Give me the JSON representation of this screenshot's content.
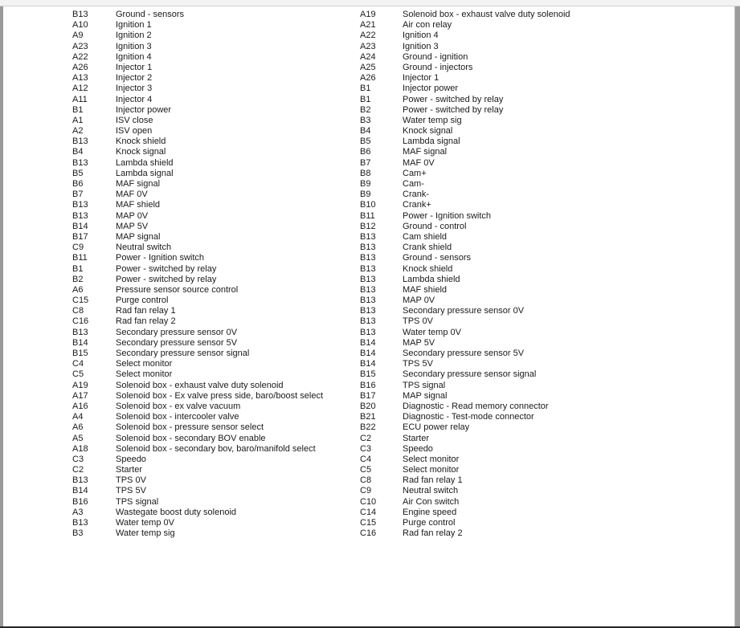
{
  "document": {
    "left_column": [
      {
        "pin": "B13",
        "description": "Ground - sensors"
      },
      {
        "pin": "A10",
        "description": "Ignition 1"
      },
      {
        "pin": "A9",
        "description": "Ignition 2"
      },
      {
        "pin": "A23",
        "description": "Ignition 3"
      },
      {
        "pin": "A22",
        "description": "Ignition 4"
      },
      {
        "pin": "A26",
        "description": "Injector 1"
      },
      {
        "pin": "A13",
        "description": "Injector 2"
      },
      {
        "pin": "A12",
        "description": "Injector 3"
      },
      {
        "pin": "A11",
        "description": "Injector 4"
      },
      {
        "pin": "B1",
        "description": "Injector power"
      },
      {
        "pin": "A1",
        "description": "ISV close"
      },
      {
        "pin": "A2",
        "description": "ISV open"
      },
      {
        "pin": "B13",
        "description": "Knock shield"
      },
      {
        "pin": "B4",
        "description": "Knock signal"
      },
      {
        "pin": "B13",
        "description": "Lambda shield"
      },
      {
        "pin": "B5",
        "description": "Lambda signal"
      },
      {
        "pin": "B6",
        "description": "MAF signal"
      },
      {
        "pin": "B7",
        "description": "MAF 0V"
      },
      {
        "pin": "B13",
        "description": "MAF shield"
      },
      {
        "pin": "B13",
        "description": "MAP 0V"
      },
      {
        "pin": "B14",
        "description": "MAP 5V"
      },
      {
        "pin": "B17",
        "description": "MAP signal"
      },
      {
        "pin": "C9",
        "description": "Neutral switch"
      },
      {
        "pin": "B11",
        "description": "Power - Ignition switch"
      },
      {
        "pin": "B1",
        "description": "Power - switched by relay"
      },
      {
        "pin": "B2",
        "description": "Power - switched by relay"
      },
      {
        "pin": "A6",
        "description": "Pressure sensor source control"
      },
      {
        "pin": "C15",
        "description": "Purge control"
      },
      {
        "pin": "C8",
        "description": "Rad fan relay 1"
      },
      {
        "pin": "C16",
        "description": "Rad fan relay 2"
      },
      {
        "pin": "B13",
        "description": "Secondary pressure sensor 0V"
      },
      {
        "pin": "B14",
        "description": "Secondary pressure sensor 5V"
      },
      {
        "pin": "B15",
        "description": "Secondary pressure sensor signal"
      },
      {
        "pin": "C4",
        "description": "Select monitor"
      },
      {
        "pin": "C5",
        "description": "Select monitor"
      },
      {
        "pin": "A19",
        "description": "Solenoid box - exhaust valve duty solenoid"
      },
      {
        "pin": "A17",
        "description": "Solenoid box - Ex valve press side, baro/boost select"
      },
      {
        "pin": "A16",
        "description": "Solenoid box - ex valve vacuum"
      },
      {
        "pin": "A4",
        "description": "Solenoid box - intercooler valve"
      },
      {
        "pin": "A6",
        "description": "Solenoid box - pressure sensor select"
      },
      {
        "pin": "A5",
        "description": "Solenoid box - secondary BOV enable"
      },
      {
        "pin": "A18",
        "description": "Solenoid box - secondary bov, baro/manifold select"
      },
      {
        "pin": "C3",
        "description": "Speedo"
      },
      {
        "pin": "C2",
        "description": "Starter"
      },
      {
        "pin": "B13",
        "description": "TPS 0V"
      },
      {
        "pin": "B14",
        "description": "TPS 5V"
      },
      {
        "pin": "B16",
        "description": "TPS signal"
      },
      {
        "pin": "A3",
        "description": "Wastegate boost duty solenoid"
      },
      {
        "pin": "B13",
        "description": "Water temp 0V"
      },
      {
        "pin": "B3",
        "description": "Water temp sig"
      }
    ],
    "right_column": [
      {
        "pin": "A19",
        "description": "Solenoid box - exhaust valve duty solenoid"
      },
      {
        "pin": "A21",
        "description": "Air con relay"
      },
      {
        "pin": "A22",
        "description": "Ignition 4"
      },
      {
        "pin": "A23",
        "description": "Ignition 3"
      },
      {
        "pin": "A24",
        "description": "Ground - ignition"
      },
      {
        "pin": "A25",
        "description": "Ground - injectors"
      },
      {
        "pin": "A26",
        "description": "Injector 1"
      },
      {
        "pin": "B1",
        "description": "Injector power"
      },
      {
        "pin": "B1",
        "description": "Power - switched by relay"
      },
      {
        "pin": "B2",
        "description": "Power - switched by relay"
      },
      {
        "pin": "B3",
        "description": "Water temp sig"
      },
      {
        "pin": "B4",
        "description": "Knock signal"
      },
      {
        "pin": "B5",
        "description": "Lambda signal"
      },
      {
        "pin": "B6",
        "description": "MAF signal"
      },
      {
        "pin": "B7",
        "description": "MAF 0V"
      },
      {
        "pin": "B8",
        "description": "Cam+"
      },
      {
        "pin": "B9",
        "description": "Cam-"
      },
      {
        "pin": "B9",
        "description": "Crank-"
      },
      {
        "pin": "B10",
        "description": "Crank+"
      },
      {
        "pin": "B11",
        "description": "Power - Ignition switch"
      },
      {
        "pin": "B12",
        "description": "Ground - control"
      },
      {
        "pin": "B13",
        "description": "Cam shield"
      },
      {
        "pin": "B13",
        "description": "Crank shield"
      },
      {
        "pin": "B13",
        "description": "Ground - sensors"
      },
      {
        "pin": "B13",
        "description": "Knock shield"
      },
      {
        "pin": "B13",
        "description": "Lambda shield"
      },
      {
        "pin": "B13",
        "description": "MAF shield"
      },
      {
        "pin": "B13",
        "description": "MAP 0V"
      },
      {
        "pin": "B13",
        "description": "Secondary pressure sensor 0V"
      },
      {
        "pin": "B13",
        "description": "TPS 0V"
      },
      {
        "pin": "B13",
        "description": "Water temp 0V"
      },
      {
        "pin": "B14",
        "description": "MAP 5V"
      },
      {
        "pin": "B14",
        "description": "Secondary pressure sensor 5V"
      },
      {
        "pin": "B14",
        "description": "TPS 5V"
      },
      {
        "pin": "B15",
        "description": "Secondary pressure sensor signal"
      },
      {
        "pin": "B16",
        "description": "TPS signal"
      },
      {
        "pin": "B17",
        "description": "MAP signal"
      },
      {
        "pin": "B20",
        "description": "Diagnostic - Read memory connector"
      },
      {
        "pin": "B21",
        "description": "Diagnostic - Test-mode connector"
      },
      {
        "pin": "B22",
        "description": "ECU power relay"
      },
      {
        "pin": "C2",
        "description": "Starter"
      },
      {
        "pin": "C3",
        "description": "Speedo"
      },
      {
        "pin": "C4",
        "description": "Select monitor"
      },
      {
        "pin": "C5",
        "description": "Select monitor"
      },
      {
        "pin": "C8",
        "description": "Rad fan relay 1"
      },
      {
        "pin": "C9",
        "description": "Neutral switch"
      },
      {
        "pin": "C10",
        "description": "Air Con switch"
      },
      {
        "pin": "C14",
        "description": "Engine speed"
      },
      {
        "pin": "C15",
        "description": "Purge control"
      },
      {
        "pin": "C16",
        "description": "Rad fan relay 2"
      }
    ]
  }
}
